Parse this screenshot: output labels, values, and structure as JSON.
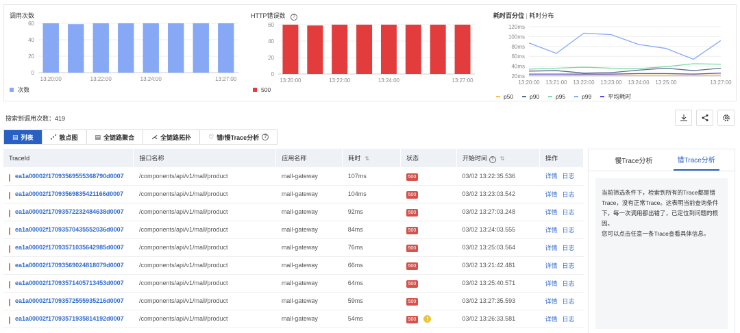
{
  "charts": {
    "calls": {
      "title": "调用次数",
      "legend": "次数",
      "color": "#86a8f5",
      "x": [
        "13:20:00",
        "13:21:00",
        "13:22:00",
        "13:23:00",
        "13:24:00",
        "13:25:00",
        "13:26:00",
        "13:27:00"
      ],
      "xticks": [
        "13:20:00",
        "13:22:00",
        "13:24:00",
        "13:27:00"
      ],
      "yticks": [
        0,
        20,
        40,
        60
      ],
      "values": [
        60,
        59,
        60,
        60,
        60,
        60,
        60,
        60
      ]
    },
    "errors": {
      "title": "HTTP错误数",
      "legend": "500",
      "color": "#e23c3c",
      "x": [
        "13:20:00",
        "13:21:00",
        "13:22:00",
        "13:23:00",
        "13:24:00",
        "13:25:00",
        "13:26:00",
        "13:27:00"
      ],
      "xticks": [
        "13:20:00",
        "13:22:00",
        "13:24:00",
        "13:27:00"
      ],
      "yticks": [
        0,
        20,
        40,
        60
      ],
      "values": [
        60,
        59,
        60,
        60,
        60,
        60,
        60,
        60
      ]
    },
    "latency": {
      "title": "耗时百分位",
      "subtitle": "耗时分布",
      "x": [
        "13:20:00",
        "13:21:00",
        "13:22:00",
        "13:23:00",
        "13:24:00",
        "13:25:00",
        "13:26:00",
        "13:27:00"
      ],
      "xticks": [
        "13:20:00",
        "13:21:00",
        "13:22:00",
        "13:23:00",
        "13:24:00",
        "13:25:00",
        "13:27:00"
      ],
      "yticks": [
        "20ms",
        "40ms",
        "60ms",
        "80ms",
        "100ms",
        "120ms"
      ],
      "ylim": [
        20,
        120
      ],
      "series": [
        {
          "name": "p50",
          "color": "#f0c050",
          "values": [
            21,
            21,
            22,
            22,
            22,
            22,
            22,
            22
          ]
        },
        {
          "name": "p90",
          "color": "#5b6b8c",
          "values": [
            30,
            31,
            26,
            27,
            32,
            36,
            31,
            36
          ]
        },
        {
          "name": "p95",
          "color": "#7dd9a6",
          "values": [
            34,
            36,
            38,
            36,
            35,
            39,
            45,
            44
          ]
        },
        {
          "name": "p99",
          "color": "#86a8f5",
          "values": [
            87,
            66,
            107,
            104,
            84,
            76,
            54,
            92
          ]
        },
        {
          "name": "平均耗时",
          "color": "#5a4de0",
          "values": [
            24,
            24,
            24,
            24,
            25,
            25,
            24,
            26
          ]
        }
      ]
    }
  },
  "count_label": "搜索到调用次数：419",
  "tabs": [
    "列表",
    "散点图",
    "全链路聚合",
    "全链路拓扑",
    "错/慢Trace分析"
  ],
  "columns": [
    "TraceId",
    "接口名称",
    "应用名称",
    "耗时",
    "状态",
    "开始时间",
    "操作"
  ],
  "actions": {
    "detail": "详情",
    "log": "日志"
  },
  "rows": [
    [
      "ea1a00002f17093569555368790d0007",
      "/components/api/v1/mall/product",
      "mall-gateway",
      "107ms",
      "500",
      "03/02 13:22:35.536"
    ],
    [
      "ea1a00002f17093569835421166d0007",
      "/components/api/v1/mall/product",
      "mall-gateway",
      "104ms",
      "500",
      "03/02 13:23:03.542"
    ],
    [
      "ea1a00002f17093572232484638d0007",
      "/components/api/v1/mall/product",
      "mall-gateway",
      "92ms",
      "500",
      "03/02 13:27:03.248"
    ],
    [
      "ea1a00002f17093570435552036d0007",
      "/components/api/v1/mall/product",
      "mall-gateway",
      "84ms",
      "500",
      "03/02 13:24:03.555"
    ],
    [
      "ea1a00002f17093571035642985d0007",
      "/components/api/v1/mall/product",
      "mall-gateway",
      "76ms",
      "500",
      "03/02 13:25:03.564"
    ],
    [
      "ea1a00002f17093569024818079d0007",
      "/components/api/v1/mall/product",
      "mall-gateway",
      "66ms",
      "500",
      "03/02 13:21:42.481"
    ],
    [
      "ea1a00002f17093571405713453d0007",
      "/components/api/v1/mall/product",
      "mall-gateway",
      "64ms",
      "500",
      "03/02 13:25:40.571"
    ],
    [
      "ea1a00002f17093572555935216d0007",
      "/components/api/v1/mall/product",
      "mall-gateway",
      "59ms",
      "500",
      "03/02 13:27:35.593"
    ],
    [
      "ea1a00002f17093571935814192d0007",
      "/components/api/v1/mall/product",
      "mall-gateway",
      "54ms",
      "500",
      "03/02 13:26:33.581"
    ]
  ],
  "warn_row": 8,
  "side": {
    "tabs": [
      "慢Trace分析",
      "错Trace分析"
    ],
    "active": 1,
    "text": "当前筛选条件下，检索到所有的Trace都是错Trace，没有正常Trace。这表明当前查询条件下，每一次调用都出错了，已定位到问题的根因。",
    "text2": "您可以点击任意一条Trace查看具体信息。"
  },
  "help_glyph": "?",
  "warn_glyph": "!"
}
